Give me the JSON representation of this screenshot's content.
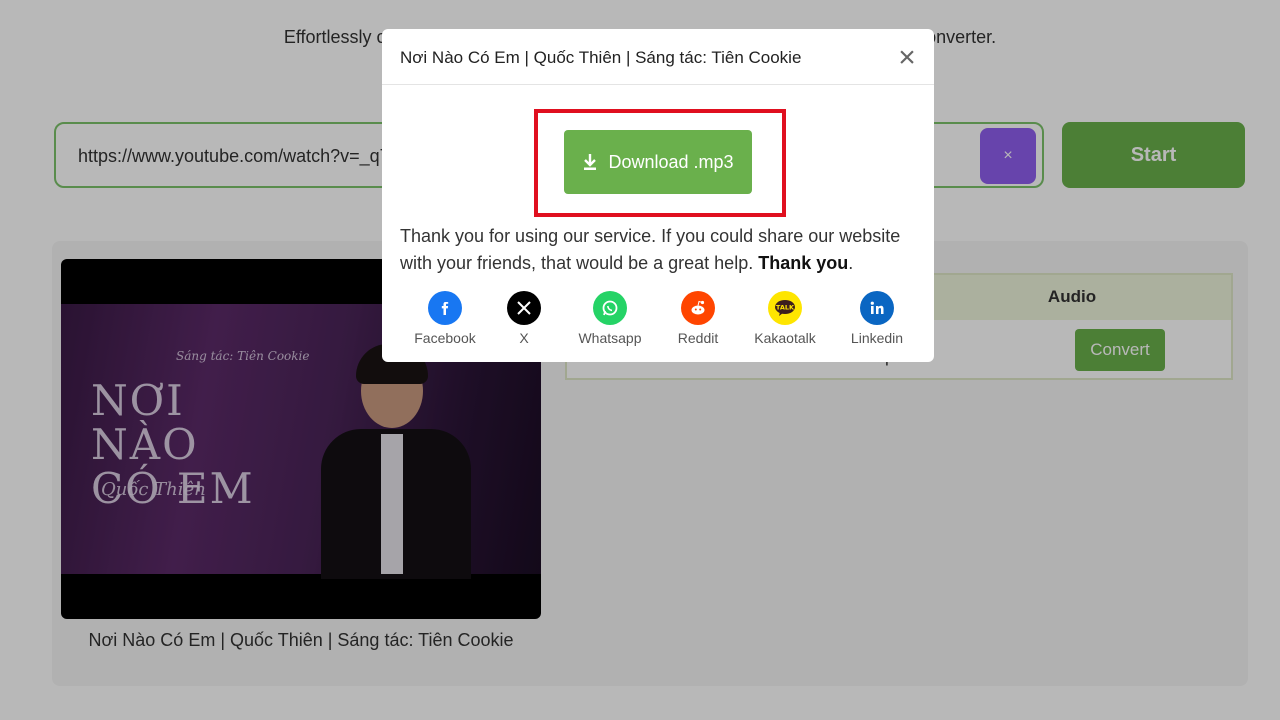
{
  "header": {
    "tagline": "Effortlessly convert YouTube videos to MP3 with our fast, free, and easy-to-use converter."
  },
  "search": {
    "value": "https://www.youtube.com/watch?v=_q7",
    "clear_label": "×",
    "start_label": "Start"
  },
  "result": {
    "video_title": "Nơi Nào Có Em | Quốc Thiên | Sáng tác: Tiên Cookie",
    "thumbnail": {
      "art_title": "NƠI NÀO CÓ EM",
      "art_subtitle": "Sáng tác: Tiên Cookie",
      "art_artist": "Quốc Thiên"
    },
    "table": {
      "column_audio": "Audio",
      "bitrate": "kbps",
      "convert_label": "Convert"
    }
  },
  "modal": {
    "title": "Nơi Nào Có Em | Quốc Thiên | Sáng tác: Tiên Cookie",
    "close_label": "×",
    "download_label": "Download .mp3",
    "thanks_text": "Thank you for using our service. If you could share our website with your friends, that would be a great help. ",
    "thanks_bold": "Thank you",
    "thanks_end": ".",
    "share": [
      {
        "label": "Facebook",
        "icon": "facebook-icon",
        "color": "#1877f2"
      },
      {
        "label": "X",
        "icon": "x-icon",
        "color": "#000000"
      },
      {
        "label": "Whatsapp",
        "icon": "whatsapp-icon",
        "color": "#25d366"
      },
      {
        "label": "Reddit",
        "icon": "reddit-icon",
        "color": "#ff4500"
      },
      {
        "label": "Kakaotalk",
        "icon": "kakaotalk-icon",
        "color": "#fee500"
      },
      {
        "label": "Linkedin",
        "icon": "linkedin-icon",
        "color": "#0a66c2"
      }
    ]
  },
  "colors": {
    "accent_green": "#6ab04c",
    "clear_purple": "#8f5fef",
    "highlight_red": "#e00f1f"
  }
}
